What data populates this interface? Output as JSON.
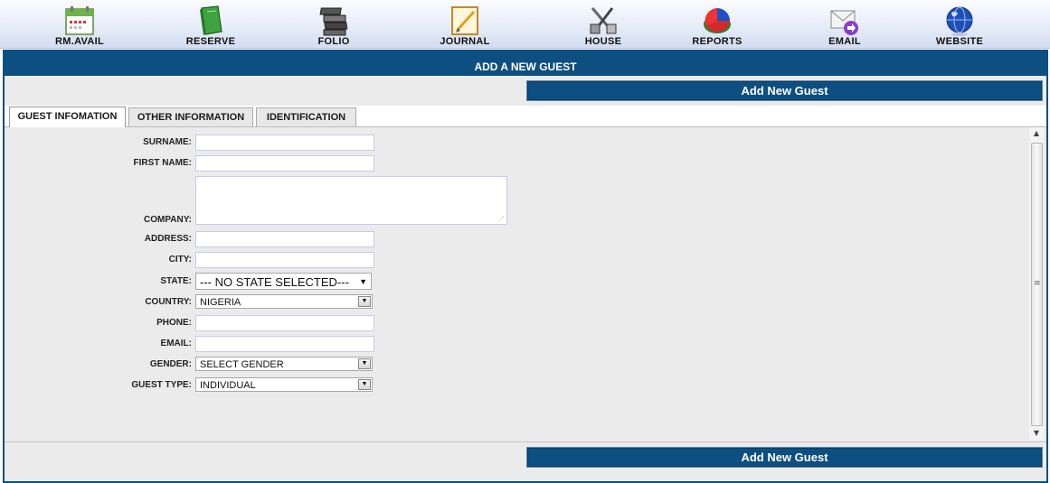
{
  "toolbar": {
    "items": [
      {
        "label": "RM.AVAIL",
        "icon": "calendar-icon"
      },
      {
        "label": "RESERVE",
        "icon": "book-icon"
      },
      {
        "label": "FOLIO",
        "icon": "books-stack-icon"
      },
      {
        "label": "JOURNAL",
        "icon": "notepad-pencil-icon"
      },
      {
        "label": "HOUSE",
        "icon": "tools-icon"
      },
      {
        "label": "REPORTS",
        "icon": "pie-chart-icon"
      },
      {
        "label": "EMAIL",
        "icon": "envelope-icon"
      },
      {
        "label": "WEBSITE",
        "icon": "globe-icon"
      }
    ]
  },
  "panel": {
    "title": "ADD A NEW GUEST",
    "add_button_label": "Add New Guest"
  },
  "tabs": [
    {
      "label": "GUEST INFOMATION",
      "active": true
    },
    {
      "label": "OTHER INFORMATION",
      "active": false
    },
    {
      "label": "IDENTIFICATION",
      "active": false
    }
  ],
  "form": {
    "surname": {
      "label": "SURNAME:",
      "value": ""
    },
    "first_name": {
      "label": "FIRST NAME:",
      "value": ""
    },
    "company": {
      "label": "COMPANY:",
      "value": ""
    },
    "address": {
      "label": "ADDRESS:",
      "value": ""
    },
    "city": {
      "label": "CITY:",
      "value": ""
    },
    "state": {
      "label": "STATE:",
      "value": "--- NO STATE SELECTED---"
    },
    "country": {
      "label": "COUNTRY:",
      "value": "NIGERIA"
    },
    "phone": {
      "label": "PHONE:",
      "value": ""
    },
    "email": {
      "label": "EMAIL:",
      "value": ""
    },
    "gender": {
      "label": "GENDER:",
      "value": "SELECT GENDER"
    },
    "guest_type": {
      "label": "GUEST TYPE:",
      "value": "INDIVIDUAL"
    }
  },
  "colors": {
    "primary": "#0d4f80",
    "panel_bg": "#ebebeb",
    "input_border": "#c9c9ee"
  }
}
